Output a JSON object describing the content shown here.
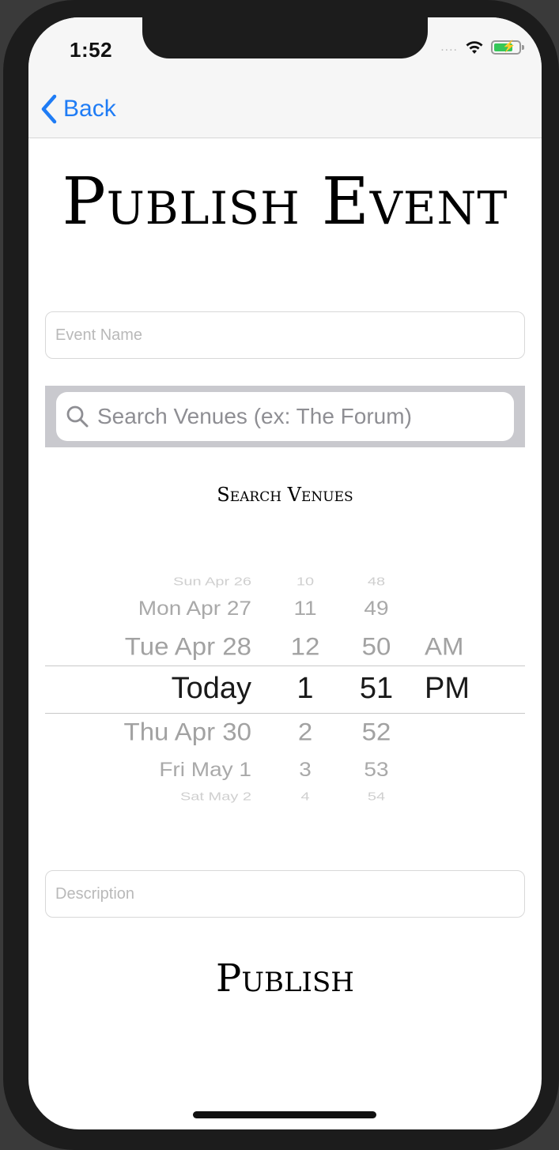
{
  "status_bar": {
    "time": "1:52",
    "signal": "....",
    "battery_level": 0.75
  },
  "nav": {
    "back_label": "Back"
  },
  "page": {
    "title": "Publish Event"
  },
  "form": {
    "event_name_placeholder": "Event Name",
    "search_placeholder": "Search Venues (ex: The Forum)",
    "search_button_label": "Search Venues",
    "description_placeholder": "Description",
    "publish_label": "Publish"
  },
  "picker": {
    "rows": [
      {
        "date": "Sun Apr 26",
        "hour": "10",
        "minute": "48",
        "ampm": ""
      },
      {
        "date": "Mon Apr 27",
        "hour": "11",
        "minute": "49",
        "ampm": ""
      },
      {
        "date": "Tue Apr 28",
        "hour": "12",
        "minute": "50",
        "ampm": "AM"
      },
      {
        "date": "Today",
        "hour": "1",
        "minute": "51",
        "ampm": "PM"
      },
      {
        "date": "Thu Apr 30",
        "hour": "2",
        "minute": "52",
        "ampm": ""
      },
      {
        "date": "Fri May 1",
        "hour": "3",
        "minute": "53",
        "ampm": ""
      },
      {
        "date": "Sat May 2",
        "hour": "4",
        "minute": "54",
        "ampm": ""
      }
    ],
    "selected_index": 3
  },
  "colors": {
    "accent": "#1f7cf5",
    "search_bar_bg": "#c9c9ce",
    "battery": "#35c759"
  }
}
